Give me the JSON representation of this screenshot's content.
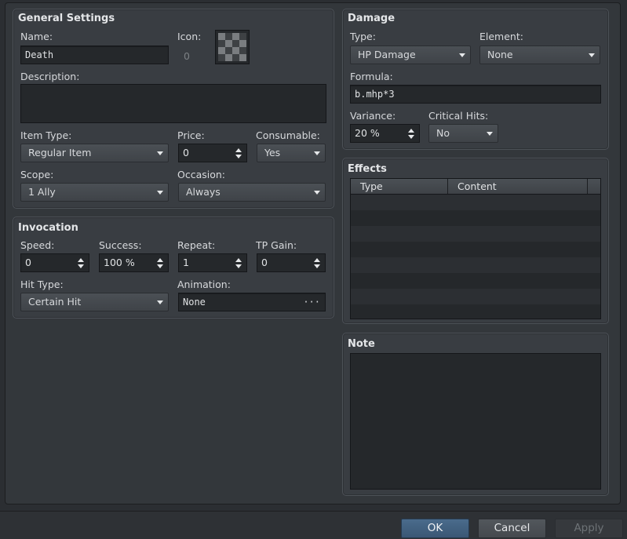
{
  "general": {
    "title": "General Settings",
    "name_label": "Name:",
    "name_value": "Death",
    "icon_label": "Icon:",
    "icon_index": "0",
    "description_label": "Description:",
    "description_value": "",
    "item_type_label": "Item Type:",
    "item_type_value": "Regular Item",
    "price_label": "Price:",
    "price_value": "0",
    "consumable_label": "Consumable:",
    "consumable_value": "Yes",
    "scope_label": "Scope:",
    "scope_value": "1 Ally",
    "occasion_label": "Occasion:",
    "occasion_value": "Always"
  },
  "invocation": {
    "title": "Invocation",
    "speed_label": "Speed:",
    "speed_value": "0",
    "success_label": "Success:",
    "success_value": "100 %",
    "repeat_label": "Repeat:",
    "repeat_value": "1",
    "tp_gain_label": "TP Gain:",
    "tp_gain_value": "0",
    "hit_type_label": "Hit Type:",
    "hit_type_value": "Certain Hit",
    "animation_label": "Animation:",
    "animation_value": "None",
    "animation_button": "···"
  },
  "damage": {
    "title": "Damage",
    "type_label": "Type:",
    "type_value": "HP Damage",
    "element_label": "Element:",
    "element_value": "None",
    "formula_label": "Formula:",
    "formula_value": "b.mhp*3",
    "variance_label": "Variance:",
    "variance_value": "20 %",
    "critical_label": "Critical Hits:",
    "critical_value": "No"
  },
  "effects": {
    "title": "Effects",
    "columns": [
      "Type",
      "Content"
    ]
  },
  "note": {
    "title": "Note",
    "value": ""
  },
  "buttons": {
    "ok": "OK",
    "cancel": "Cancel",
    "apply": "Apply"
  },
  "colors": {
    "background": "#2b2e32",
    "panel": "#393d42",
    "field": "#25282b",
    "ok_button": "#3a5775"
  }
}
